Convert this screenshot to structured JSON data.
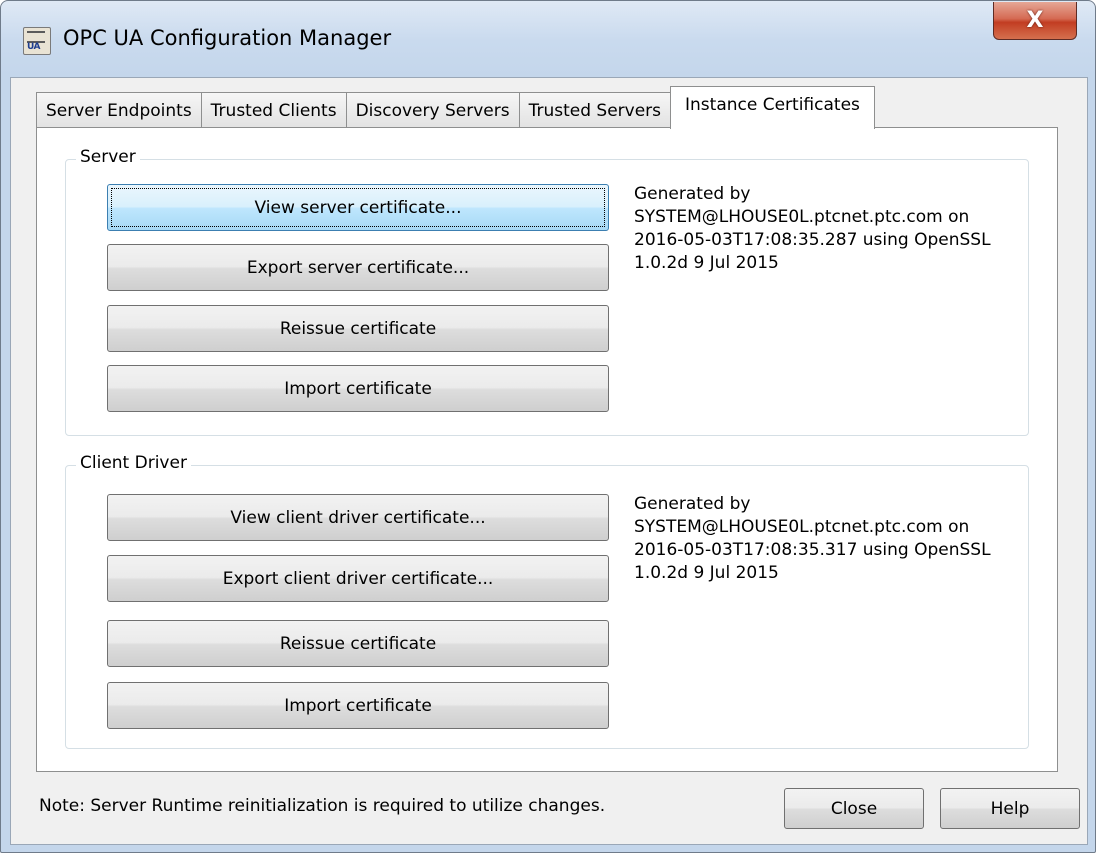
{
  "window": {
    "title": "OPC UA Configuration Manager",
    "close_glyph": "X",
    "app_icon_text": "UA"
  },
  "tabs": [
    {
      "label": "Server Endpoints",
      "active": false
    },
    {
      "label": "Trusted Clients",
      "active": false
    },
    {
      "label": "Discovery Servers",
      "active": false
    },
    {
      "label": "Trusted Servers",
      "active": false
    },
    {
      "label": "Instance Certificates",
      "active": true
    }
  ],
  "server_group": {
    "label": "Server",
    "buttons": {
      "view": "View server certificate...",
      "export": "Export server certificate...",
      "reissue": "Reissue certificate",
      "import": "Import certificate"
    },
    "info_lines": [
      "Generated by",
      "SYSTEM@LHOUSE0L.ptcnet.ptc.com on",
      "2016-05-03T17:08:35.287 using OpenSSL",
      "1.0.2d 9 Jul 2015"
    ]
  },
  "client_group": {
    "label": "Client Driver",
    "buttons": {
      "view": "View client driver certificate...",
      "export": "Export client driver certificate...",
      "reissue": "Reissue certificate",
      "import": "Import certificate"
    },
    "info_lines": [
      "Generated by",
      "SYSTEM@LHOUSE0L.ptcnet.ptc.com on",
      "2016-05-03T17:08:35.317 using OpenSSL",
      "1.0.2d 9 Jul 2015"
    ]
  },
  "footer": {
    "note": "Note:  Server Runtime reinitialization is required to utilize changes.",
    "close_label": "Close",
    "help_label": "Help"
  },
  "colors": {
    "titlebar": "#c4d6eb",
    "close_button": "#c23d22",
    "focused_button": "#bee6fd"
  }
}
